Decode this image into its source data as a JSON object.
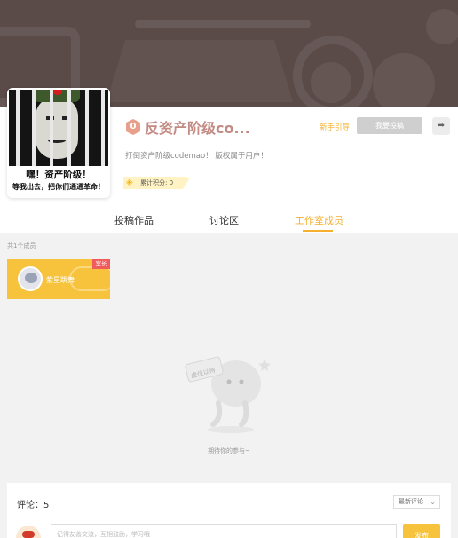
{
  "studio": {
    "level": "0",
    "title": "反资产阶级co...",
    "guide_link": "新手引导",
    "submit_label": "我要投稿",
    "description": "打倒资产阶级codemao！   版权属于用户！",
    "points_label": "累计积分: 0",
    "avatar_caption_1": "嘿！资产阶级！",
    "avatar_caption_2": "等我出去，把你们通通革命！"
  },
  "tabs": [
    {
      "label": "投稿作品",
      "active": false
    },
    {
      "label": "讨论区",
      "active": false
    },
    {
      "label": "工作室成员",
      "active": true
    }
  ],
  "members": {
    "count_text": "共1个成员",
    "list": [
      {
        "name": "紫星跳舞",
        "badge": "室长"
      }
    ]
  },
  "empty_state": {
    "sign_text": "虚位以待",
    "message": "期待你的参与~"
  },
  "comments": {
    "count_text": "评论：5",
    "sort_label": "最新评论",
    "input_placeholder": "记得友善交流，互相鼓励，学习哦~",
    "publish_label": "发布"
  },
  "colors": {
    "accent": "#f5b02e",
    "banner": "#5a4a48",
    "card": "#f8c33c",
    "owner_badge": "#f15a5a"
  }
}
